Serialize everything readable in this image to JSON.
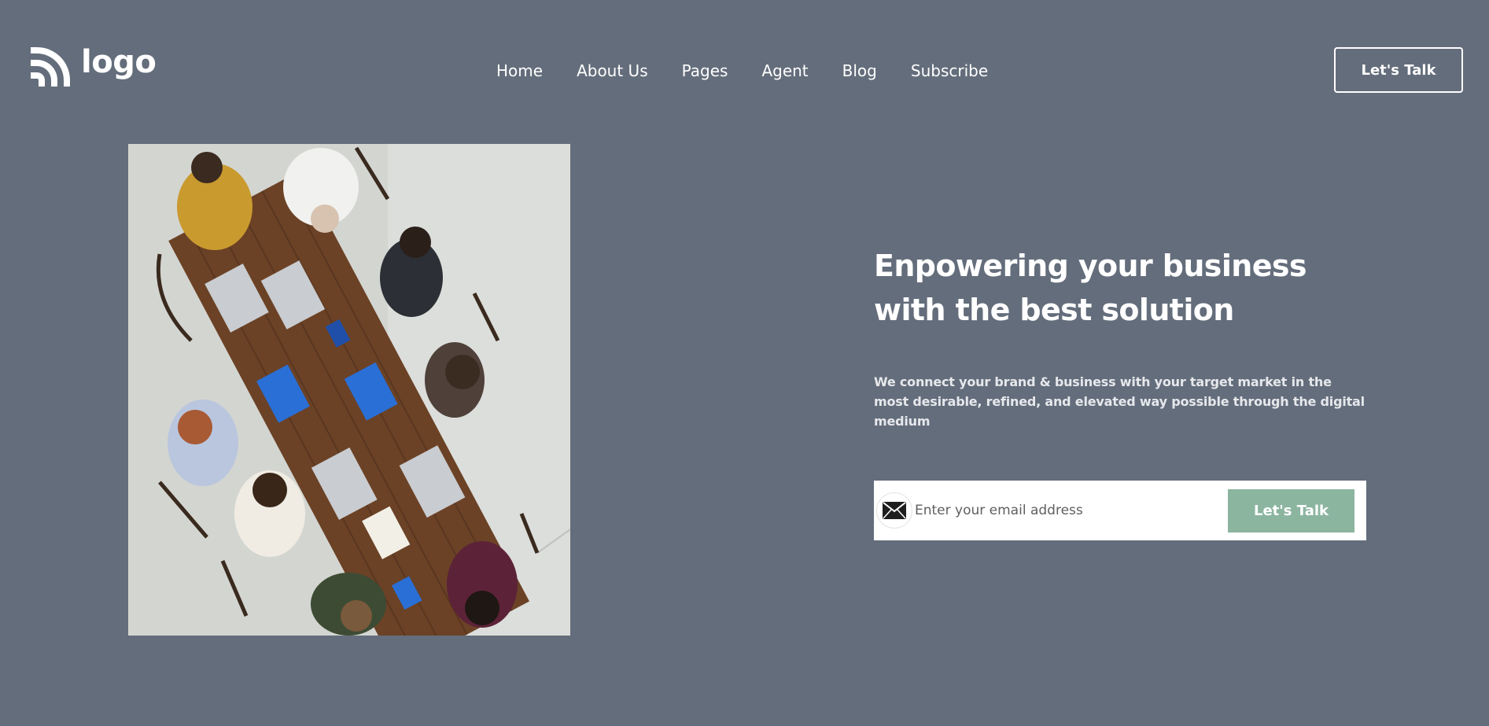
{
  "header": {
    "logo_text": "logo",
    "nav": [
      {
        "label": "Home"
      },
      {
        "label": "About Us"
      },
      {
        "label": "Pages"
      },
      {
        "label": "Agent"
      },
      {
        "label": "Blog"
      },
      {
        "label": "Subscribe"
      }
    ],
    "cta_label": "Let's Talk"
  },
  "hero": {
    "image_icon": "team-meeting-photo",
    "title": "Enpowering your business with the best solution",
    "subtitle": "We connect your brand & business with your target market in the most desirable, refined, and elevated way possible through the digital medium",
    "form": {
      "icon": "envelope-icon",
      "email_placeholder": "Enter your email address",
      "email_value": "",
      "submit_label": "Let's Talk"
    }
  },
  "colors": {
    "background": "#646d7b",
    "accent_button": "#8cb5a0",
    "text": "#ffffff"
  }
}
